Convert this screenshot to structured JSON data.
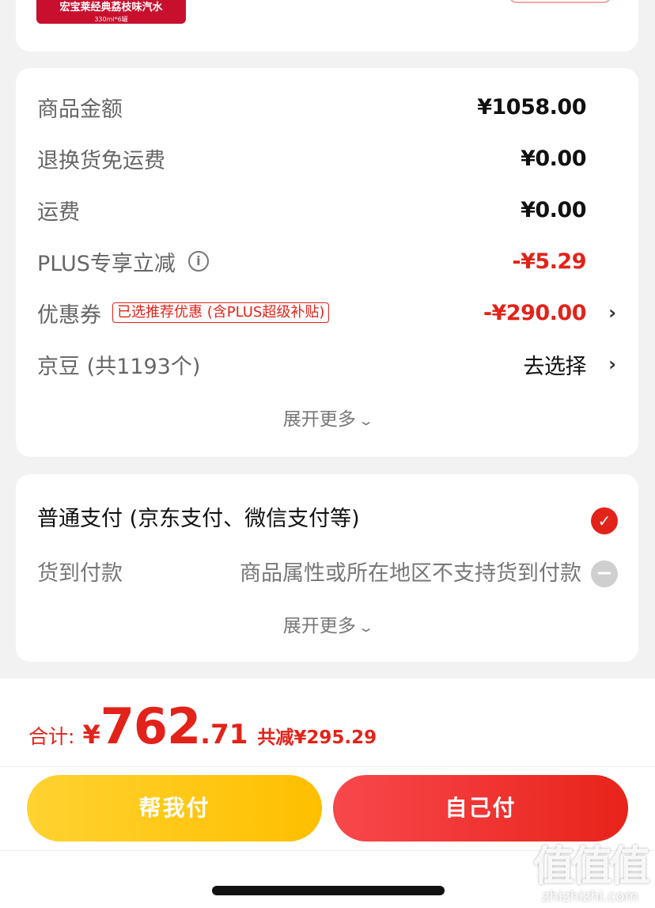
{
  "product": {
    "name": "宏宝莱经典荔枝味汽水",
    "spec": "330ml*6罐"
  },
  "price_summary": {
    "rows": [
      {
        "label": "商品金额",
        "value": "¥1058.00"
      },
      {
        "label": "退换货免运费",
        "value": "¥0.00"
      },
      {
        "label": "运费",
        "value": "¥0.00"
      },
      {
        "label": "PLUS专享立减",
        "value": "-¥5.29"
      },
      {
        "label": "优惠券",
        "tag": "已选推荐优惠 (含PLUS超级补贴)",
        "value": "-¥290.00"
      },
      {
        "label": "京豆 (共1193个)",
        "value": "去选择"
      }
    ],
    "expand_label": "展开更多"
  },
  "payment": {
    "options": [
      {
        "label": "普通支付 (京东支付、微信支付等)"
      },
      {
        "label": "货到付款",
        "note": "商品属性或所在地区不支持货到付款"
      }
    ],
    "expand_label": "展开更多"
  },
  "footer": {
    "total_label": "合计:",
    "currency": "¥",
    "total_int": "762",
    "total_dec": ".71",
    "saved": "共减¥295.29",
    "help_pay": "帮我付",
    "self_pay": "自己付"
  },
  "watermark": {
    "logo": "值值值",
    "site": "zhizhizhi.com"
  },
  "colors": {
    "accent_red": "#e2231a",
    "help_yellow": "#ffc617",
    "background": "#f2f2f2"
  }
}
